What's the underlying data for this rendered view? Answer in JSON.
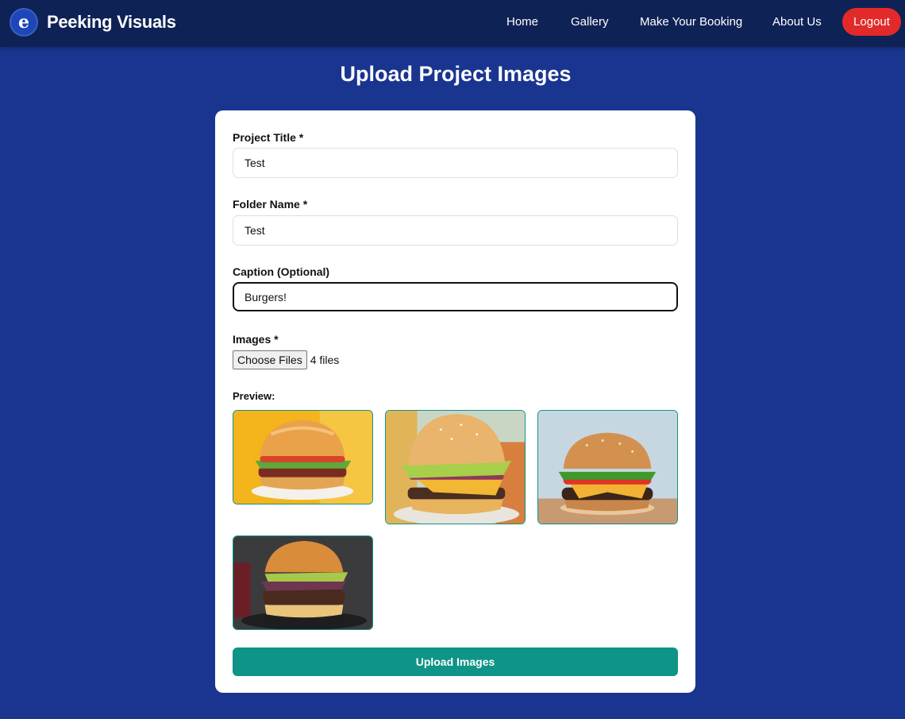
{
  "nav": {
    "brand": "Peeking Visuals",
    "links": [
      "Home",
      "Gallery",
      "Make Your Booking",
      "About Us"
    ],
    "logout": "Logout"
  },
  "page_title": "Upload Project Images",
  "form": {
    "project_title_label": "Project Title *",
    "project_title_value": "Test",
    "folder_name_label": "Folder Name *",
    "folder_name_value": "Test",
    "caption_label": "Caption (Optional)",
    "caption_value": "Burgers!",
    "images_label": "Images *",
    "choose_files": "Choose Files",
    "file_count": "4 files",
    "preview_label": "Preview:",
    "upload_button": "Upload Images"
  },
  "preview_images": [
    "burger-image-1",
    "burger-image-2",
    "burger-image-3",
    "burger-image-4"
  ],
  "colors": {
    "page_bg": "#1a3590",
    "navbar_bg": "#0f2256",
    "logout_bg": "#e22a2a",
    "accent_teal": "#0f9488"
  }
}
